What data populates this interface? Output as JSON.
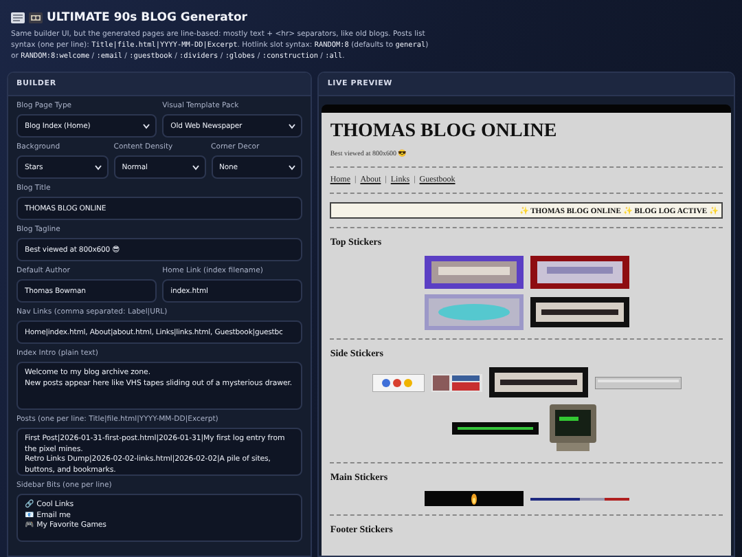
{
  "header": {
    "title": "ULTIMATE 90s BLOG Generator",
    "description": [
      {
        "kind": "text",
        "text": "Same builder UI, but the generated pages are line-based: mostly text + <hr> separators, like old blogs. Posts list syntax (one per line): "
      },
      {
        "kind": "code",
        "text": "Title|file.html|YYYY-MM-DD|Excerpt"
      },
      {
        "kind": "text",
        "text": ". Hotlink slot syntax: "
      },
      {
        "kind": "code",
        "text": "RANDOM:8"
      },
      {
        "kind": "text",
        "text": " (defaults to "
      },
      {
        "kind": "code",
        "text": "general"
      },
      {
        "kind": "text",
        "text": ") or "
      },
      {
        "kind": "code",
        "text": "RANDOM:8:welcome"
      },
      {
        "kind": "text",
        "text": " / "
      },
      {
        "kind": "code",
        "text": ":email"
      },
      {
        "kind": "text",
        "text": " / "
      },
      {
        "kind": "code",
        "text": ":guestbook"
      },
      {
        "kind": "text",
        "text": " / "
      },
      {
        "kind": "code",
        "text": ":dividers"
      },
      {
        "kind": "text",
        "text": " / "
      },
      {
        "kind": "code",
        "text": ":globes"
      },
      {
        "kind": "text",
        "text": " / "
      },
      {
        "kind": "code",
        "text": ":construction"
      },
      {
        "kind": "text",
        "text": " / "
      },
      {
        "kind": "code",
        "text": ":all"
      },
      {
        "kind": "text",
        "text": "."
      }
    ]
  },
  "builder": {
    "heading": "BUILDER",
    "rows": [
      [
        {
          "kind": "select",
          "label": "Blog Page Type",
          "value": "Blog Index (Home)"
        },
        {
          "kind": "select",
          "label": "Visual Template Pack",
          "value": "Old Web Newspaper"
        }
      ],
      [
        {
          "kind": "select",
          "label": "Background",
          "value": "Stars"
        },
        {
          "kind": "select",
          "label": "Content Density",
          "value": "Normal"
        },
        {
          "kind": "select",
          "label": "Corner Decor",
          "value": "None"
        }
      ],
      [
        {
          "kind": "input",
          "label": "Blog Title",
          "value": "THOMAS BLOG ONLINE"
        }
      ],
      [
        {
          "kind": "input",
          "label": "Blog Tagline",
          "value": "Best viewed at 800x600 😎"
        }
      ],
      [
        {
          "kind": "input",
          "label": "Default Author",
          "value": "Thomas Bowman"
        },
        {
          "kind": "input",
          "label": "Home Link (index filename)",
          "value": "index.html"
        }
      ],
      [
        {
          "kind": "input",
          "label": "Nav Links (comma separated: Label|URL)",
          "value": "Home|index.html, About|about.html, Links|links.html, Guestbook|guestbc"
        }
      ],
      [
        {
          "kind": "textarea",
          "label": "Index Intro (plain text)",
          "value": "Welcome to my blog archive zone.\nNew posts appear here like VHS tapes sliding out of a mysterious drawer."
        }
      ],
      [
        {
          "kind": "textarea",
          "label": "Posts (one per line: Title|file.html|YYYY-MM-DD|Excerpt)",
          "value": "First Post|2026-01-31-first-post.html|2026-01-31|My first log entry from the pixel mines.\nRetro Links Dump|2026-02-02-links.html|2026-02-02|A pile of sites, buttons, and bookmarks."
        }
      ],
      [
        {
          "kind": "textarea",
          "label": "Sidebar Bits (one per line)",
          "value": "🔗 Cool Links\n📧 Email me\n🎮 My Favorite Games"
        }
      ]
    ]
  },
  "preview": {
    "heading": "LIVE PREVIEW",
    "title": "THOMAS BLOG ONLINE",
    "tagline": "Best viewed at 800x600 😎",
    "nav_links": [
      "Home",
      "About",
      "Links",
      "Guestbook"
    ],
    "nav_separator": "|",
    "marquee": "✨ THOMAS BLOG ONLINE ✨ BLOG LOG ACTIVE ✨",
    "sections": [
      {
        "heading": "Top Stickers"
      },
      {
        "heading": "Side Stickers"
      },
      {
        "heading": "Main Stickers"
      },
      {
        "heading": "Footer Stickers"
      }
    ]
  }
}
